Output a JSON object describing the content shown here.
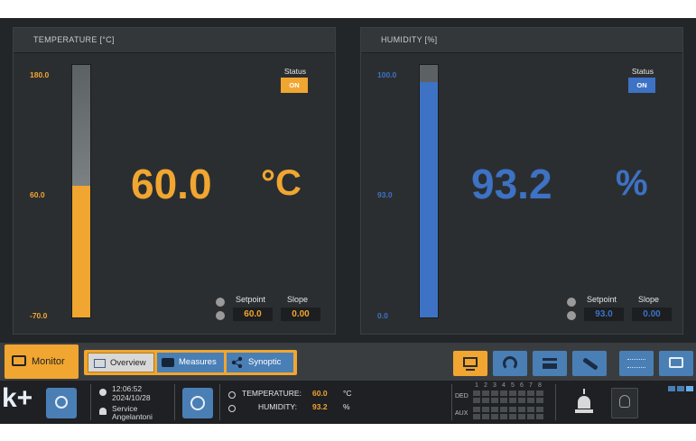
{
  "temperature": {
    "header": "TEMPERATURE [°C]",
    "ticks": {
      "max": "180.0",
      "mid": "60.0",
      "min": "-70.0"
    },
    "value": "60.0",
    "unit": "°C",
    "level_fraction": 0.52,
    "status_label": "Status",
    "status_value": "ON",
    "setpoint_label": "Setpoint",
    "slope_label": "Slope",
    "setpoint_value": "60.0",
    "slope_value": "0.00",
    "accent_color": "#f0a630"
  },
  "humidity": {
    "header": "HUMIDITY [%]",
    "ticks": {
      "max": "100.0",
      "mid": "93.0",
      "min": "0.0"
    },
    "value": "93.2",
    "unit": "%",
    "level_fraction": 0.932,
    "status_label": "Status",
    "status_value": "ON",
    "setpoint_label": "Setpoint",
    "slope_label": "Slope",
    "setpoint_value": "93.0",
    "slope_value": "0.00",
    "accent_color": "#3d72c4"
  },
  "nav": {
    "monitor_label": "Monitor",
    "tabs": [
      {
        "label": "Overview",
        "icon": "overview-icon",
        "active": true
      },
      {
        "label": "Measures",
        "icon": "camera-icon",
        "active": false
      },
      {
        "label": "Synoptic",
        "icon": "synoptic-icon",
        "active": false
      }
    ],
    "tool_icons": [
      "monitor-icon",
      "refresh-icon",
      "menu-icon",
      "wrench-icon",
      "options-icon",
      "chat-icon"
    ]
  },
  "status_bar": {
    "logo": "k+",
    "time": "12:06:52",
    "date": "2024/10/28",
    "user_role": "Service",
    "user_name": "Angelantoni",
    "readouts": [
      {
        "label": "TEMPERATURE:",
        "value": "60.0",
        "unit": "°C"
      },
      {
        "label": "HUMIDITY:",
        "value": "93.2",
        "unit": "%"
      }
    ],
    "ded_label": "DED",
    "aux_label": "AUX",
    "channel_numbers": [
      "1",
      "2",
      "3",
      "4",
      "5",
      "6",
      "7",
      "8"
    ]
  }
}
